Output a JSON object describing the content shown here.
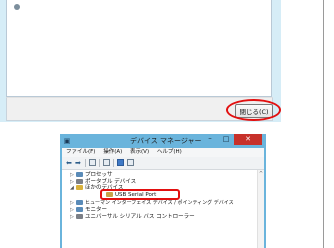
{
  "dialog": {
    "close_button_label": "閉じる(C)"
  },
  "device_manager": {
    "title": "デバイス マネージャー",
    "window_buttons": {
      "minimize": "–",
      "maximize": "□",
      "close": "✕"
    },
    "menu": [
      "ファイル(F)",
      "操作(A)",
      "表示(V)",
      "ヘルプ(H)"
    ],
    "tree": [
      {
        "label": "プロセッサ",
        "expanded": false,
        "icon": "cpu-icon"
      },
      {
        "label": "ポータブル デバイス",
        "expanded": false,
        "icon": "portable-device-icon"
      },
      {
        "label": "ほかのデバイス",
        "expanded": true,
        "icon": "other-devices-icon"
      },
      {
        "label": "USB Serial Port",
        "child": true,
        "icon": "warning-port-icon",
        "highlighted": true
      },
      {
        "label": "ヒューマン インターフェイス デバイス / ポインティング デバイス",
        "expanded": false,
        "icon": "hid-icon"
      },
      {
        "label": "モニター",
        "expanded": false,
        "icon": "monitor-icon"
      },
      {
        "label": "ユニバーサル シリアル バス コントローラー",
        "expanded": false,
        "icon": "usb-controller-icon"
      }
    ]
  },
  "colors": {
    "highlight_red": "#e21010",
    "titlebar_blue": "#6ab4dc",
    "close_red": "#c7312a"
  }
}
